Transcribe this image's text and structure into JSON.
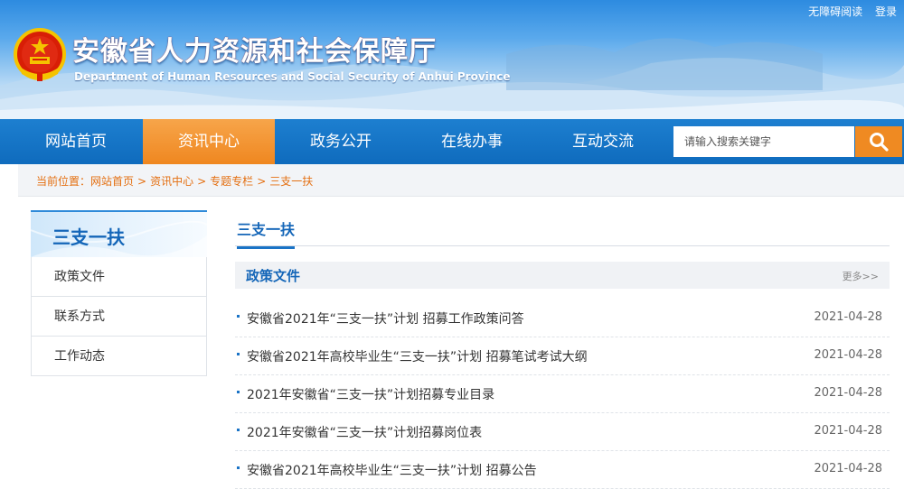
{
  "header": {
    "title": "安徽省人力资源和社会保障厅",
    "subtitle": "Department of Human Resources and Social Security of Anhui Province",
    "top_links": [
      "无障碍阅读",
      "登录"
    ],
    "emblem_icon": "national-emblem-icon"
  },
  "nav": {
    "items": [
      {
        "label": "网站首页"
      },
      {
        "label": "资讯中心"
      },
      {
        "label": "政务公开"
      },
      {
        "label": "在线办事"
      },
      {
        "label": "互动交流"
      }
    ],
    "active_index": 1,
    "active_color": "#ef8720",
    "bar_color": "#1673c6"
  },
  "search": {
    "placeholder": "请输入搜索关键字",
    "button_icon": "search-icon",
    "button_color": "#ef8a22"
  },
  "breadcrumb": {
    "prefix": "当前位置：",
    "items": [
      "网站首页",
      "资讯中心",
      "专题专栏",
      "三支一扶"
    ],
    "separator": ">"
  },
  "sidebar": {
    "title": "三支一扶",
    "items": [
      {
        "label": "政策文件"
      },
      {
        "label": "联系方式"
      },
      {
        "label": "工作动态"
      }
    ]
  },
  "main": {
    "tab_label": "三支一扶",
    "section": {
      "title": "政策文件",
      "more": "更多>>"
    },
    "news": [
      {
        "title": "安徽省2021年“三支一扶”计划 招募工作政策问答",
        "date": "2021-04-28"
      },
      {
        "title": "安徽省2021年高校毕业生“三支一扶”计划 招募笔试考试大纲",
        "date": "2021-04-28"
      },
      {
        "title": "2021年安徽省“三支一扶”计划招募专业目录",
        "date": "2021-04-28"
      },
      {
        "title": "2021年安徽省“三支一扶”计划招募岗位表",
        "date": "2021-04-28"
      },
      {
        "title": "安徽省2021年高校毕业生“三支一扶”计划 招募公告",
        "date": "2021-04-28"
      }
    ]
  }
}
